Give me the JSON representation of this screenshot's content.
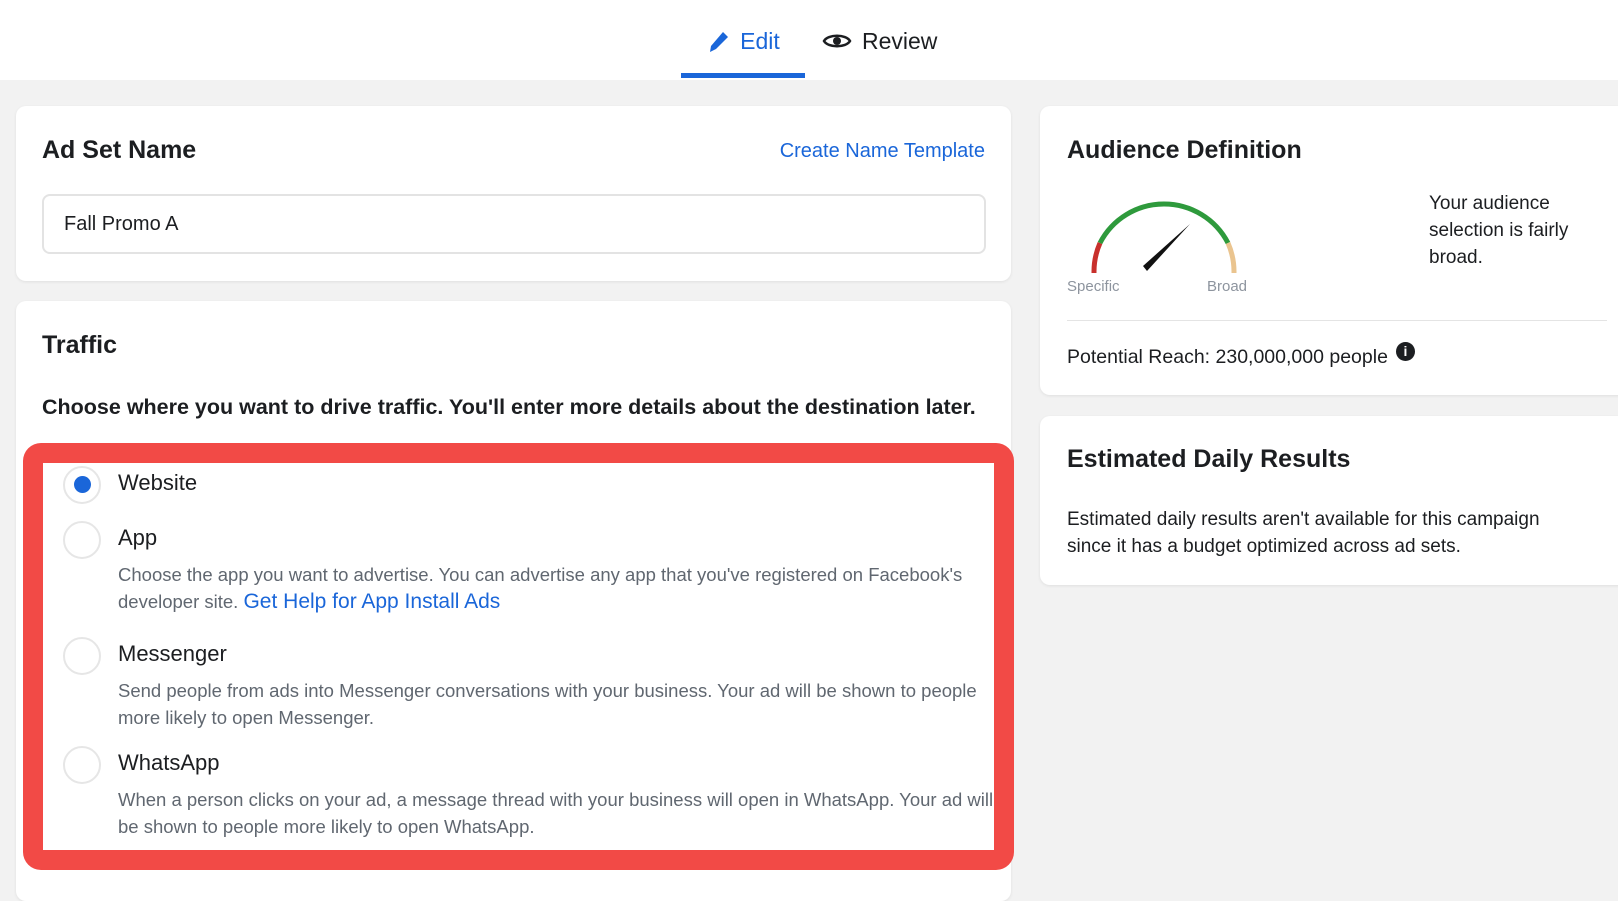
{
  "tabs": {
    "edit": "Edit",
    "review": "Review"
  },
  "ad_set": {
    "title": "Ad Set Name",
    "template_link": "Create Name Template",
    "name_value": "Fall Promo A"
  },
  "traffic": {
    "title": "Traffic",
    "prompt": "Choose where you want to drive traffic. You'll enter more details about the destination later.",
    "options": [
      {
        "label": "Website",
        "selected": true
      },
      {
        "label": "App",
        "description": "Choose the app you want to advertise. You can advertise any app that you've registered on Facebook's developer site.",
        "link": "Get Help for App Install Ads"
      },
      {
        "label": "Messenger",
        "description": "Send people from ads into Messenger conversations with your business. Your ad will be shown to people more likely to open Messenger."
      },
      {
        "label": "WhatsApp",
        "description": "When a person clicks on your ad, a message thread with your business will open in WhatsApp. Your ad will be shown to people more likely to open WhatsApp."
      }
    ]
  },
  "audience": {
    "title": "Audience Definition",
    "gauge_low": "Specific",
    "gauge_high": "Broad",
    "summary": "Your audience selection is fairly broad.",
    "reach": "Potential Reach: 230,000,000 people"
  },
  "estimates": {
    "title": "Estimated Daily Results",
    "text": "Estimated daily results aren't available for this campaign since it has a budget optimized across ad sets."
  },
  "colors": {
    "accent": "#1a66d9",
    "highlight": "#f24a46"
  }
}
